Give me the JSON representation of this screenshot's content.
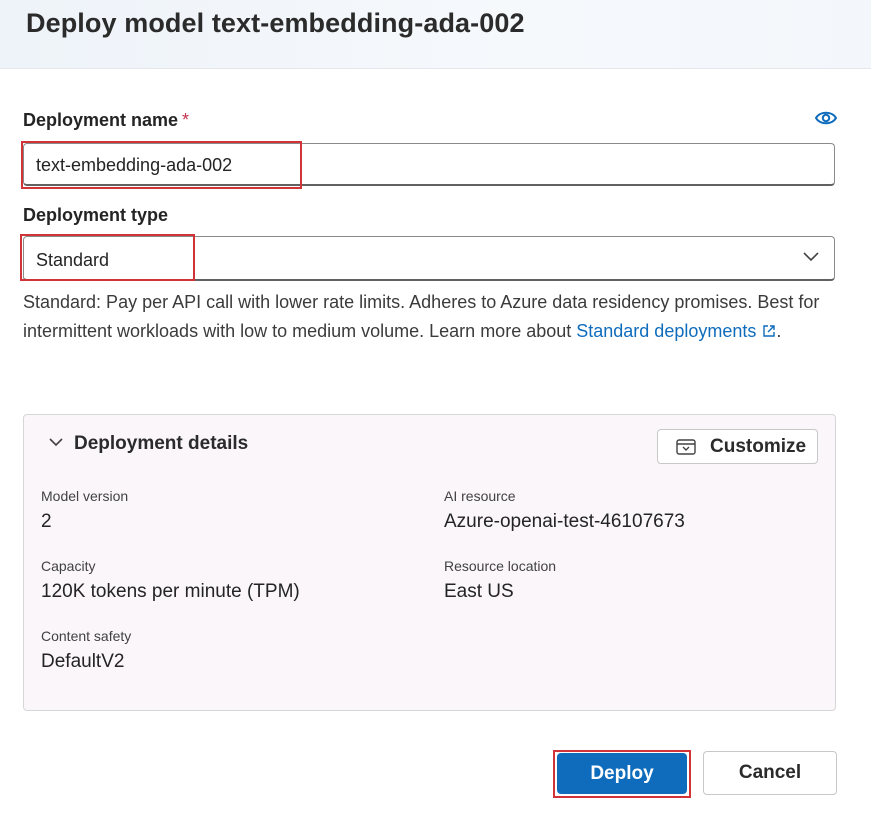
{
  "dialog": {
    "title": "Deploy model text-embedding-ada-002"
  },
  "deployment_name": {
    "label": "Deployment name",
    "required_mark": "*",
    "value": "text-embedding-ada-002",
    "info_icon": "eye-icon"
  },
  "deployment_type": {
    "label": "Deployment type",
    "value": "Standard",
    "icon": "chevron-down-icon",
    "description_pre": "Standard: Pay per API call with lower rate limits. Adheres to Azure data residency promises. Best for intermittent workloads with low to medium volume. Learn more about ",
    "link_text": "Standard deployments",
    "description_post": "."
  },
  "details": {
    "header": "Deployment details",
    "customize_label": "Customize",
    "model_version_label": "Model version",
    "model_version": "2",
    "ai_resource_label": "AI resource",
    "ai_resource": "Azure-openai-test-46107673",
    "capacity_label": "Capacity",
    "capacity": "120K tokens per minute (TPM)",
    "resource_location_label": "Resource location",
    "resource_location": "East US",
    "content_safety_label": "Content safety",
    "content_safety": "DefaultV2"
  },
  "actions": {
    "deploy_label": "Deploy",
    "cancel_label": "Cancel"
  },
  "colors": {
    "accent": "#0f6cbd",
    "highlight": "#d13438",
    "required": "#c4314b"
  }
}
